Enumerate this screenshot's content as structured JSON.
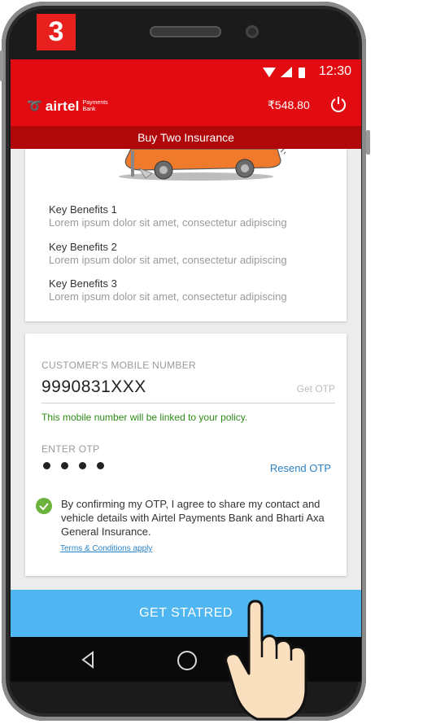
{
  "step_badge": "3",
  "status_bar": {
    "time": "12:30"
  },
  "header": {
    "brand": "airtel",
    "brand_sub_1": "Payments",
    "brand_sub_2": "Bank",
    "balance": "₹548.80"
  },
  "subheader": "Buy Two Insurance",
  "benefits": [
    {
      "title": "Key Benefits 1",
      "desc": "Lorem ipsum dolor sit amet, consectetur adipiscing"
    },
    {
      "title": "Key Benefits 2",
      "desc": "Lorem ipsum dolor sit amet, consectetur adipiscing"
    },
    {
      "title": "Key Benefits 3",
      "desc": "Lorem ipsum dolor sit amet, consectetur adipiscing"
    }
  ],
  "form": {
    "mobile_label": "CUSTOMER'S MOBILE NUMBER",
    "mobile_value": "9990831XXX",
    "get_otp": "Get OTP",
    "link_message": "This mobile number will be linked to your policy.",
    "otp_label": "ENTER OTP",
    "resend_otp": "Resend OTP",
    "consent_text": "By confirming my OTP, I agree to share my contact and vehicle details with Airtel Payments Bank and Bharti Axa General Insurance.",
    "terms_link": "Terms & Conditions apply"
  },
  "cta_label": "GET STATRED",
  "colors": {
    "brand_red": "#e10b11",
    "cta_blue": "#4fb6f1",
    "success_green": "#2e8b18",
    "link_blue": "#2a83c6"
  }
}
